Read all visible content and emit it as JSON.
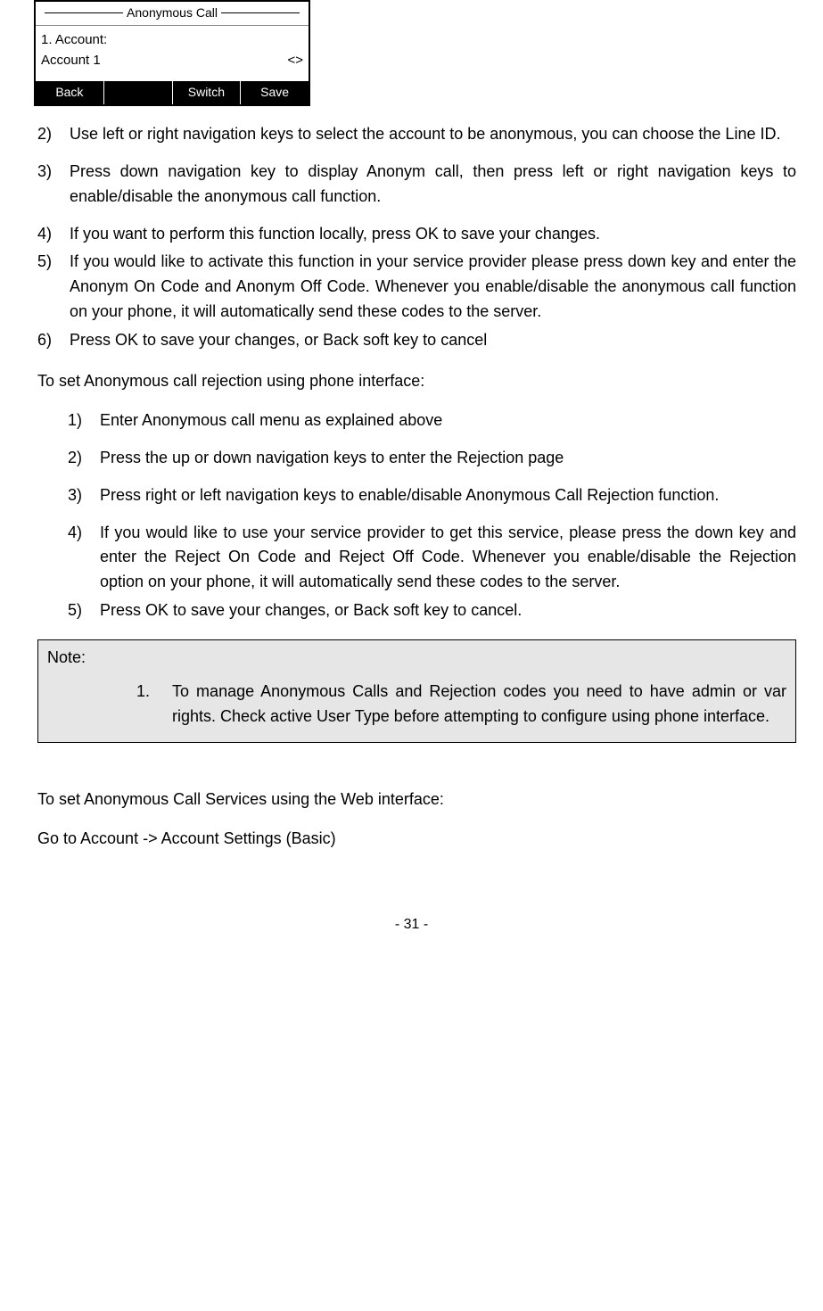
{
  "phone_ui": {
    "title": "Anonymous Call",
    "row_label": "1. Account:",
    "account_value": "Account 1",
    "selector_glyph": "<>",
    "softkeys": {
      "back": "Back",
      "switch": "Switch",
      "save": "Save",
      "blank": ""
    }
  },
  "list_a": {
    "items": [
      {
        "marker": "2)",
        "text": "Use left or right navigation keys to select the account to be anonymous, you can choose the Line ID."
      },
      {
        "marker": "3)",
        "text": "Press down navigation key to display Anonym call, then press left or right navigation keys to enable/disable the anonymous call function."
      },
      {
        "marker": "4)",
        "text": "If you want to perform this function locally, press OK to save your changes."
      },
      {
        "marker": "5)",
        "text": "If you would like to activate this function in your service provider please press down key and enter the Anonym On Code and Anonym Off Code. Whenever you enable/disable the anonymous call function on your phone, it will automatically send these codes to the server."
      },
      {
        "marker": "6)",
        "text": "Press OK to save your changes, or Back soft key to cancel"
      }
    ]
  },
  "heading_rejection": "To set Anonymous call rejection using phone interface:",
  "list_b": {
    "items": [
      {
        "marker": "1)",
        "text": "Enter Anonymous call menu as explained above"
      },
      {
        "marker": "2)",
        "text": "Press the up or down navigation keys to enter the Rejection page"
      },
      {
        "marker": "3)",
        "text": "Press right or left navigation keys to enable/disable Anonymous Call Rejection function."
      },
      {
        "marker": "4)",
        "text": "If you would like to use your service provider to get this service, please press the down key and enter the Reject On Code and Reject Off Code. Whenever you enable/disable the Rejection option on your phone, it will automatically send these codes to the server."
      },
      {
        "marker": "5)",
        "text": "Press OK to save your changes, or Back soft key to cancel."
      }
    ]
  },
  "note": {
    "label": "Note:",
    "marker": "1.",
    "body": "To manage Anonymous Calls and Rejection codes you need to have admin or var rights. Check active User Type before attempting to configure using phone interface."
  },
  "heading_web": "To set Anonymous Call Services using the Web interface:",
  "web_path": "Go to Account -> Account Settings (Basic)",
  "page_number": "- 31 -"
}
